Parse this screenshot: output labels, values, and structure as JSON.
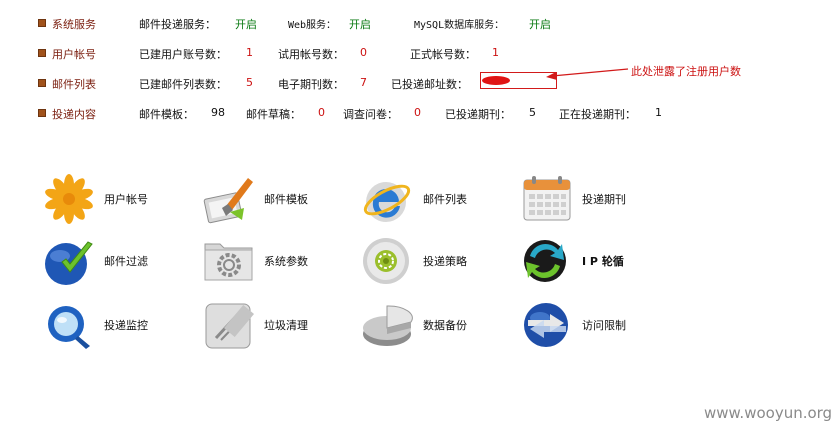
{
  "status": {
    "system": {
      "category": "系统服务",
      "mail_service_label": "邮件投递服务：",
      "mail_service_value": "开启",
      "web_service_label": "Web服务：",
      "web_service_value": "开启",
      "mysql_service_label": "MySQL数据库服务：",
      "mysql_service_value": "开启"
    },
    "accounts": {
      "category": "用户帐号",
      "created_label": "已建用户账号数：",
      "created_value": "1",
      "trial_label": "试用帐号数：",
      "trial_value": "0",
      "formal_label": "正式帐号数：",
      "formal_value": "1"
    },
    "mail_lists": {
      "category": "邮件列表",
      "created_label": "已建邮件列表数：",
      "created_value": "5",
      "periodicals_label": "电子期刊数：",
      "periodicals_value": "7",
      "delivered_addr_label": "已投递邮址数："
    },
    "delivery": {
      "category": "投递内容",
      "templates_label": "邮件模板：",
      "templates_value": "98",
      "drafts_label": "邮件草稿：",
      "drafts_value": "0",
      "surveys_label": "调查问卷：",
      "surveys_value": "0",
      "delivered_label": "已投递期刊：",
      "delivered_value": "5",
      "delivering_label": "正在投递期刊：",
      "delivering_value": "1"
    }
  },
  "annotation": {
    "text": "此处泄露了注册用户数"
  },
  "tiles": [
    {
      "label": "用户帐号",
      "icon": "flower-icon"
    },
    {
      "label": "邮件模板",
      "icon": "paint-brush-icon"
    },
    {
      "label": "邮件列表",
      "icon": "ie-globe-icon"
    },
    {
      "label": "投递期刊",
      "icon": "calendar-icon"
    },
    {
      "label": "邮件过滤",
      "icon": "globe-check-icon"
    },
    {
      "label": "系统参数",
      "icon": "gear-folder-icon"
    },
    {
      "label": "投递策略",
      "icon": "disc-icon"
    },
    {
      "label": "I P 轮循",
      "icon": "sync-arrows-icon"
    },
    {
      "label": "投递监控",
      "icon": "magnifier-icon"
    },
    {
      "label": "垃圾清理",
      "icon": "shredder-icon"
    },
    {
      "label": "数据备份",
      "icon": "pie-disk-icon"
    },
    {
      "label": "访问限制",
      "icon": "globe-arrows-icon"
    }
  ],
  "watermark": "www.wooyun.org",
  "colors": {
    "category_text": "#7a1d0e",
    "status_on": "#0a7a12",
    "count_value": "#cc1111",
    "annotation": "#cc1111",
    "bullet": "#a0521b"
  }
}
